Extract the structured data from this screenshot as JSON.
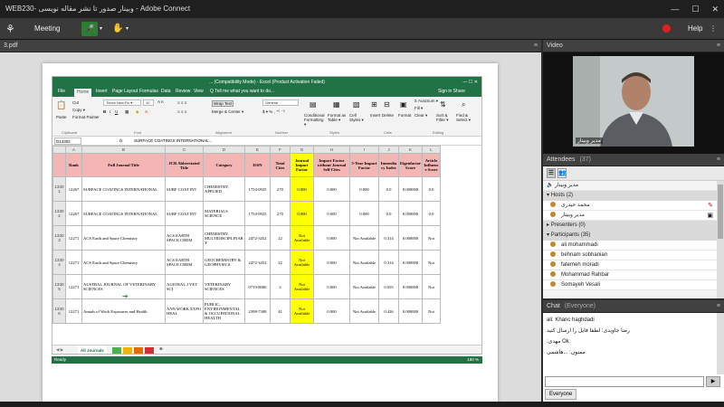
{
  "window": {
    "title": "WEB230- وبینار صدور تا نشر مقاله نویسی - Adobe Connect",
    "controls": [
      "—",
      "☐",
      "✕"
    ]
  },
  "menubar": {
    "meeting": "Meeting",
    "help": "Help",
    "record_color": "#e02020"
  },
  "share": {
    "pod_title": "3.pdf",
    "excel": {
      "title": "... (Compatibility Mode) - Excel (Product Activation Failed)",
      "tabs": [
        "File",
        "Home",
        "Insert",
        "Page Layout",
        "Formulas",
        "Data",
        "Review",
        "View",
        "Q Tell me what you want to do..."
      ],
      "signin": "Sign in   Share",
      "ribbon": {
        "cut": "Cut",
        "copy": "Copy ▾",
        "format_painter": "Format Painter",
        "paste": "Paste",
        "font": "Times New Ro ▾",
        "size": "10",
        "wrap": "Wrap Text",
        "merge": "Merge & Center ▾",
        "numfmt": "General",
        "cond": "Conditional Formatting ▾",
        "fmt_table": "Format as Table ▾",
        "cell_styles": "Cell Styles ▾",
        "insert": "Insert",
        "delete": "Delete",
        "format": "Format",
        "autosum": "Σ AutoSum ▾",
        "fill": "Fill ▾",
        "clear": "Clear ▾",
        "sort": "Sort & Filter ▾",
        "find": "Find & Select ▾",
        "groups": [
          "Clipboard",
          "Font",
          "Alignment",
          "Number",
          "Styles",
          "Cells",
          "Editing"
        ]
      },
      "formula": {
        "namebox": "D13302",
        "fx": "fx",
        "content": "SURFACE COATINGS INTERNATIONAL..."
      },
      "columns": [
        "",
        "A",
        "B",
        "C",
        "D",
        "E",
        "F",
        "G",
        "H",
        "I",
        "J",
        "K",
        "L"
      ],
      "headers": [
        "Rank",
        "Full Journal Title",
        "JCR Abbreviated Title",
        "Category",
        "ISSN",
        "Total Cites",
        "Journal Impact Factor",
        "Impact Factor without Journal Self Cites",
        "5-Year Impact Factor",
        "Immediacy Index",
        "Eigenfactor Score",
        "Article Influence Score"
      ],
      "rows": [
        {
          "rn": "13301",
          "cells": [
            "12267",
            "SURFACE COATINGS INTERNATIONAL",
            "SURF COAT INT",
            "CHEMISTRY, APPLIED",
            "1754-0925",
            "270",
            "0.000",
            "0.000",
            "0.000",
            "0.0",
            "0.000000",
            "0.0"
          ]
        },
        {
          "rn": "13302",
          "cells": [
            "12267",
            "SURFACE COATINGS INTERNATIONAL",
            "SURF COAT INT",
            "MATERIALS SCIENCE",
            "1754-0925",
            "270",
            "0.000",
            "0.000",
            "0.000",
            "0.0",
            "0.000000",
            "0.0"
          ]
        },
        {
          "rn": "13303",
          "cells": [
            "12271",
            "ACS Earth and Space Chemistry",
            "ACS EARTH SPACE CHEM",
            "CHEMISTRY, MULTIDISCIPLINARY",
            "2472-3452",
            "22",
            "Not Available",
            "0.000",
            "Not Available",
            "0.314",
            "0.000000",
            "Not"
          ]
        },
        {
          "rn": "13304",
          "cells": [
            "12271",
            "ACS Earth and Space Chemistry",
            "ACS EARTH SPACE CHEM",
            "GEOCHEMISTRY & GEOPHYSICS",
            "2472-3452",
            "22",
            "Not Available",
            "0.000",
            "Not Available",
            "0.314",
            "0.000000",
            "Not"
          ]
        },
        {
          "rn": "13305",
          "cells": [
            "12271",
            "AUSTRAL JOURNAL OF VETERINARY SCIENCES",
            "AUSTRAL J VET SCI",
            "VETERINARY SCIENCES",
            "0719-8000",
            "2",
            "Not Available",
            "0.000",
            "Not Available",
            "0.055",
            "0.000000",
            "Not"
          ]
        },
        {
          "rn": "13306",
          "cells": [
            "12271",
            "Annals of Work Exposures and Health",
            "ANN WORK EXPO HEAL",
            "PUBLIC, ENVIRONMENTAL & OCCUPATIONAL HEALTH",
            "2398-7308",
            "41",
            "Not Available",
            "0.000",
            "Not Available",
            "0.426",
            "0.000000",
            "Not"
          ]
        }
      ],
      "sheet_tab": "All Journals",
      "status": "Ready",
      "zoom": "160 %",
      "highlight_color": "#ffff00",
      "header_color": "#f4b6b5",
      "excel_green": "#217346"
    }
  },
  "video": {
    "pod_title": "Video",
    "label": "مدیر وبینار"
  },
  "attendees": {
    "pod_title": "Attendees",
    "count": "(37)",
    "active_speakers": "مدیر وبینار",
    "hosts_label": "Hosts (2)",
    "hosts": [
      "محمد حیدری",
      "مدیر وبینار"
    ],
    "presenters_label": "Presenters (0)",
    "participants_label": "Participants (35)",
    "participants": [
      "ali mohammadi",
      "behnam sobhanian",
      "fatemeh moradi",
      "Mohammad Rahbar",
      "Somayeh Vesali"
    ]
  },
  "chat": {
    "pod_title": "Chat",
    "scope": "(Everyone)",
    "messages": [
      "ali: Khanc haghdadi",
      "رضا جاویدی: لطفا فایل را ارسال کنید",
      ":مهدی Ok",
      "ممنون: ...هاشمی"
    ],
    "tab": "Everyone",
    "send": "▶"
  }
}
